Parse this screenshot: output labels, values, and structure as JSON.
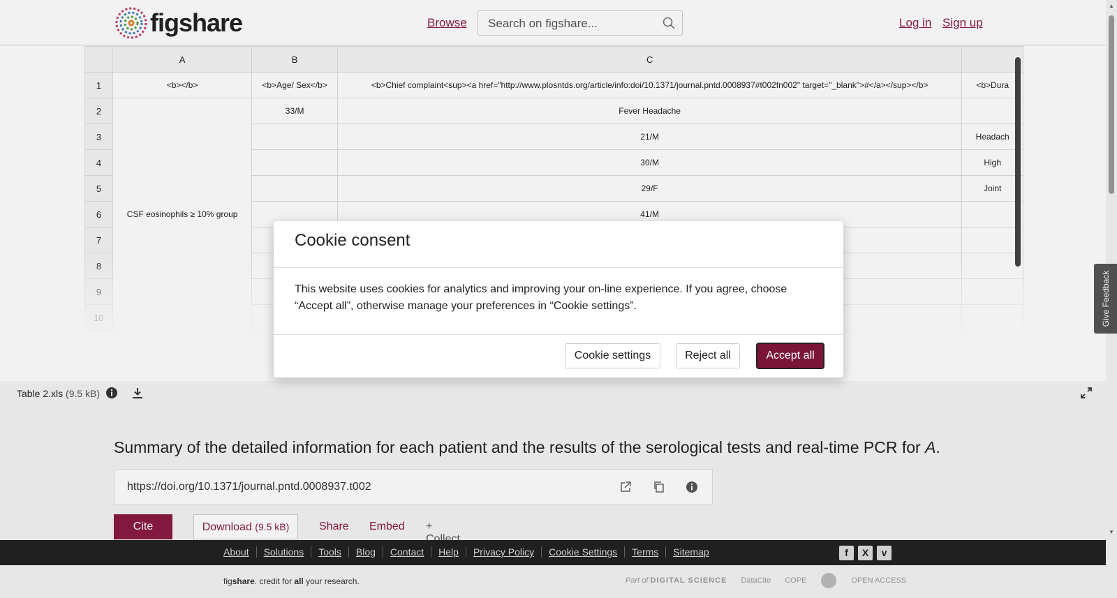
{
  "header": {
    "logo_text": "figshare",
    "browse": "Browse",
    "search_placeholder": "Search on figshare...",
    "login": "Log in",
    "signup": "Sign up"
  },
  "spreadsheet": {
    "columns": [
      "A",
      "B",
      "C"
    ],
    "column_d_partial": "",
    "row_numbers": [
      "1",
      "2",
      "3",
      "4",
      "5",
      "6",
      "7",
      "8",
      "9",
      "10"
    ],
    "r1": {
      "a": "<b></b>",
      "b": "<b>Age/ Sex</b>",
      "c": "<b>Chief complaint<sup><a href=\"http://www.plosntds.org/article/info:doi/10.1371/journal.pntd.0008937#t002fn002\" target=\"_blank\">#</a></sup></b>",
      "d": "<b>Dura"
    },
    "group_label": "CSF eosinophils ≥ 10% group",
    "r2": {
      "b": "33/M",
      "c": "Fever Headache",
      "d": ""
    },
    "r3": {
      "c": "21/M",
      "d": "Headach"
    },
    "r4": {
      "c": "30/M",
      "d": "High"
    },
    "r5": {
      "c": "29/F",
      "d": "Joint"
    },
    "r6": {
      "c": "41/M",
      "d": ""
    }
  },
  "file": {
    "name": "Table 2.xls",
    "size": "(9.5 kB)"
  },
  "title": "Summary of the detailed information for each patient and the results of the serological tests and real-time PCR for",
  "title_italic": "A",
  "title_end": ".",
  "doi": "https://doi.org/10.1371/journal.pntd.0008937.t002",
  "actions": {
    "cite": "Cite",
    "download": "Download",
    "download_size": "(9.5 kB)",
    "share": "Share",
    "embed": "Embed",
    "collect": "+ Collect"
  },
  "feedback": "Give Feedback",
  "modal": {
    "title": "Cookie consent",
    "body": "This website uses cookies for analytics and improving your on-line experience. If you agree, choose “Accept all”, otherwise manage your preferences in “Cookie settings”.",
    "settings": "Cookie settings",
    "reject": "Reject all",
    "accept": "Accept all"
  },
  "footer": {
    "links": [
      "About",
      "Solutions",
      "Tools",
      "Blog",
      "Contact",
      "Help",
      "Privacy Policy",
      "Cookie Settings",
      "Terms",
      "Sitemap"
    ],
    "tagline_1": "fig",
    "tagline_2": "share",
    "tagline_3": ". credit for ",
    "tagline_4": "all",
    "tagline_5": " your research.",
    "partners": [
      "Part of",
      "DIGITAL SCIENCE",
      "DataCite",
      "COPE",
      "OPEN ACCESS"
    ]
  },
  "colors": {
    "brand": "#8b1a43",
    "footer_bg": "#222222"
  }
}
